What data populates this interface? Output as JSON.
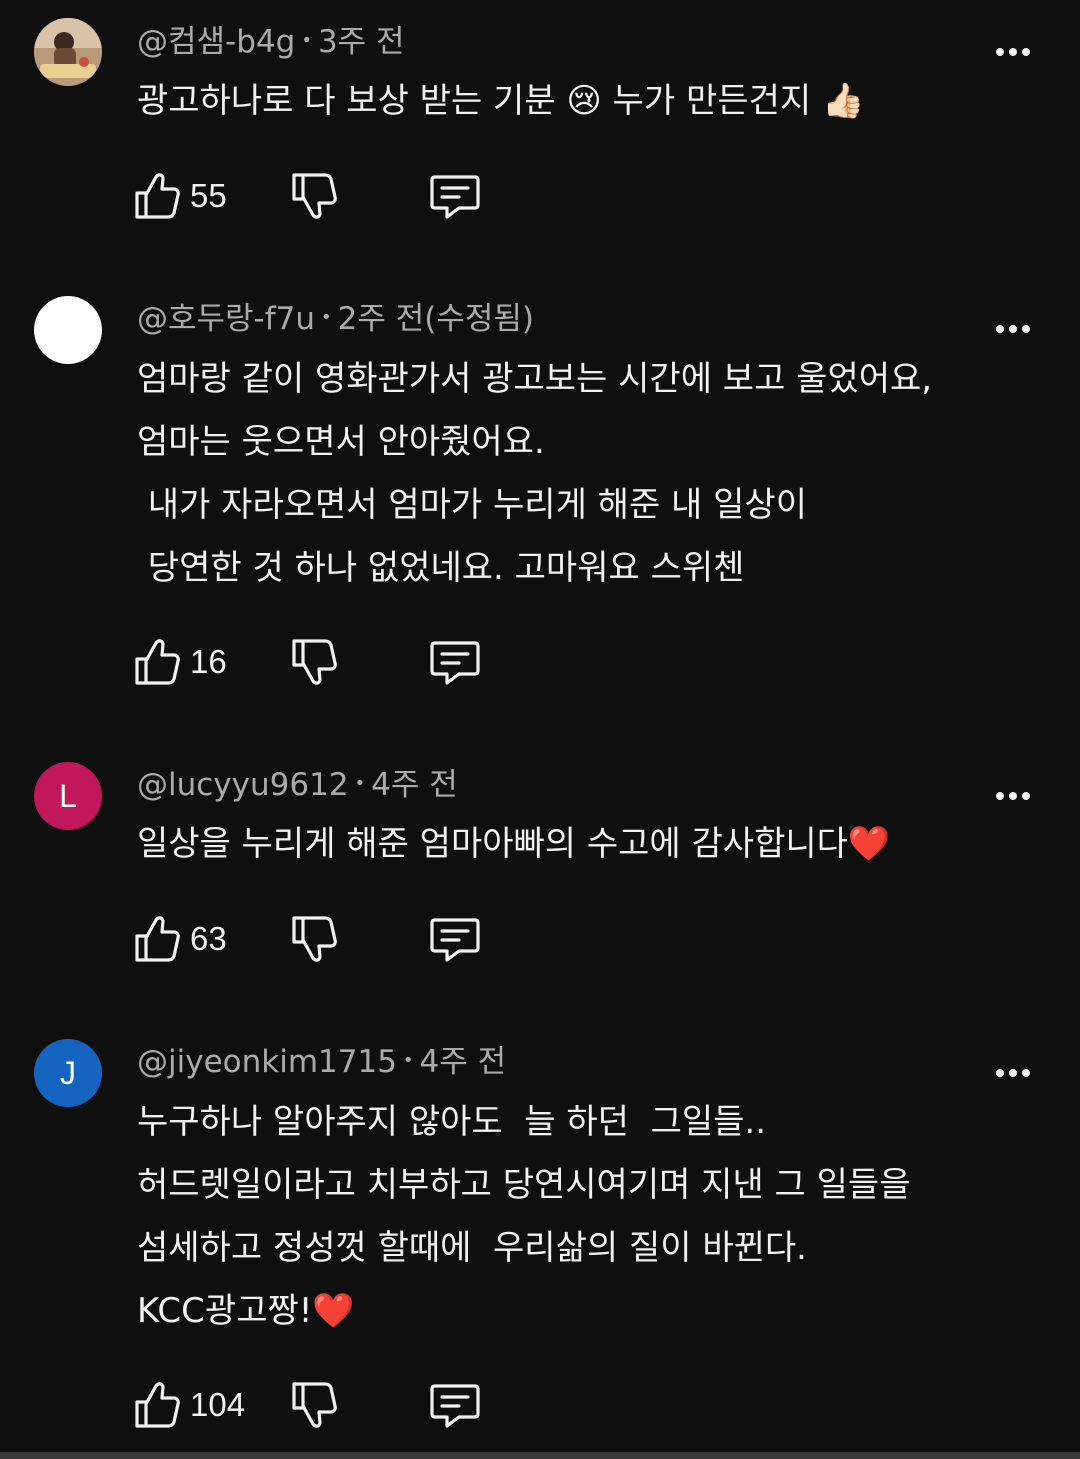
{
  "comments": [
    {
      "author": "@컴샘-b4g",
      "time": "3주 전",
      "avatar_letter": "",
      "avatar_color": "#8a6a50",
      "lines": [
        "광고하나로 다 보상 받는 기분 😢 누가 만든건지 👍🏻"
      ],
      "likes": "55"
    },
    {
      "author": "@호두랑-f7u",
      "time": "2주 전(수정됨)",
      "avatar_letter": "",
      "avatar_color": "#ffffff",
      "lines": [
        "엄마랑 같이 영화관가서 광고보는 시간에 보고 울었어요,",
        "엄마는 웃으면서 안아줬어요.",
        " 내가 자라오면서 엄마가 누리게 해준 내 일상이",
        " 당연한 것 하나 없었네요. 고마워요 스위첸"
      ],
      "likes": "16"
    },
    {
      "author": "@lucyyu9612",
      "time": "4주 전",
      "avatar_letter": "L",
      "avatar_color": "#c2185b",
      "lines": [
        "일상을 누리게 해준 엄마아빠의 수고에 감사합니다❤️"
      ],
      "likes": "63"
    },
    {
      "author": "@jiyeonkim1715",
      "time": "4주 전",
      "avatar_letter": "J",
      "avatar_color": "#1565c0",
      "lines": [
        "누구하나 알아주지 않아도  늘 하던  그일들..",
        "허드렛일이라고 치부하고 당연시여기며 지낸 그 일들을",
        "섬세하고 정성껏 할때에  우리삶의 질이 바뀐다.",
        "KCC광고짱!❤️"
      ],
      "likes": "104"
    }
  ],
  "icons": {
    "like": "thumbs-up-icon",
    "dislike": "thumbs-down-icon",
    "reply": "comment-icon",
    "more": "more-vertical-dots-icon"
  },
  "colors": {
    "background": "#0f0f0f",
    "text": "#f1f1f1",
    "meta": "#aaaaaa"
  }
}
